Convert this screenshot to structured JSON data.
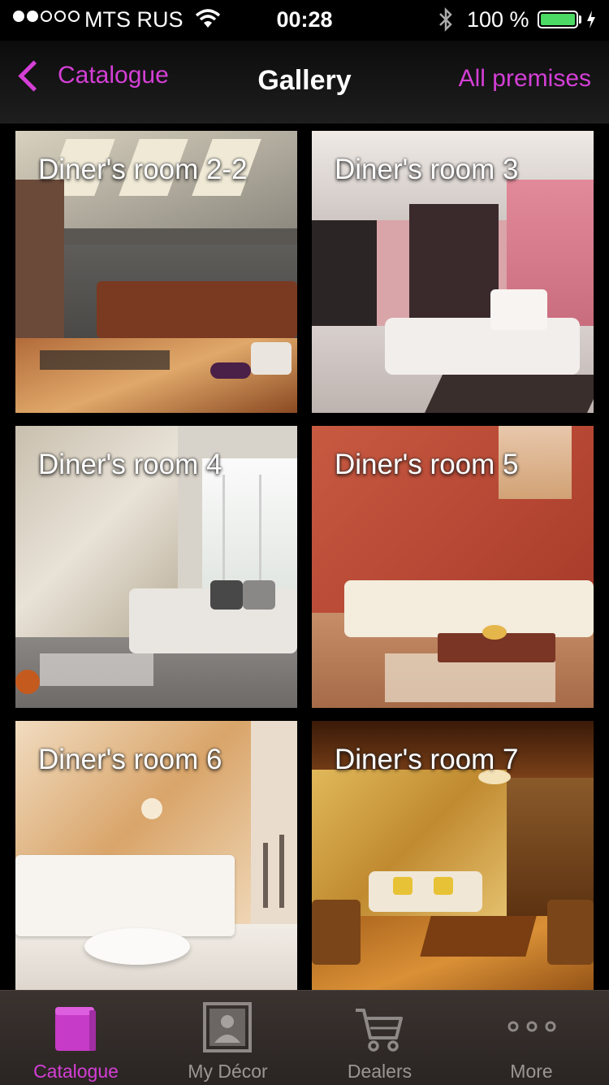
{
  "status_bar": {
    "carrier": "MTS RUS",
    "time": "00:28",
    "battery_percent": "100 %",
    "battery_level": 1.0,
    "signal_strength": 2,
    "signal_max": 5
  },
  "nav": {
    "back_label": "Catalogue",
    "title": "Gallery",
    "right_label": "All premises"
  },
  "gallery": {
    "items": [
      {
        "label": "Diner's room 2-2"
      },
      {
        "label": "Diner's room 3"
      },
      {
        "label": "Diner's room 4"
      },
      {
        "label": "Diner's room 5"
      },
      {
        "label": "Diner's room 6"
      },
      {
        "label": "Diner's room 7"
      }
    ]
  },
  "tab_bar": {
    "tabs": [
      {
        "label": "Catalogue",
        "icon": "book-icon",
        "active": true
      },
      {
        "label": "My Décor",
        "icon": "portrait-icon",
        "active": false
      },
      {
        "label": "Dealers",
        "icon": "cart-icon",
        "active": false
      },
      {
        "label": "More",
        "icon": "more-dots-icon",
        "active": false
      }
    ]
  },
  "colors": {
    "accent": "#d43fd6",
    "background": "#000000",
    "tab_bar": "#2f2825",
    "battery": "#4cd964"
  }
}
